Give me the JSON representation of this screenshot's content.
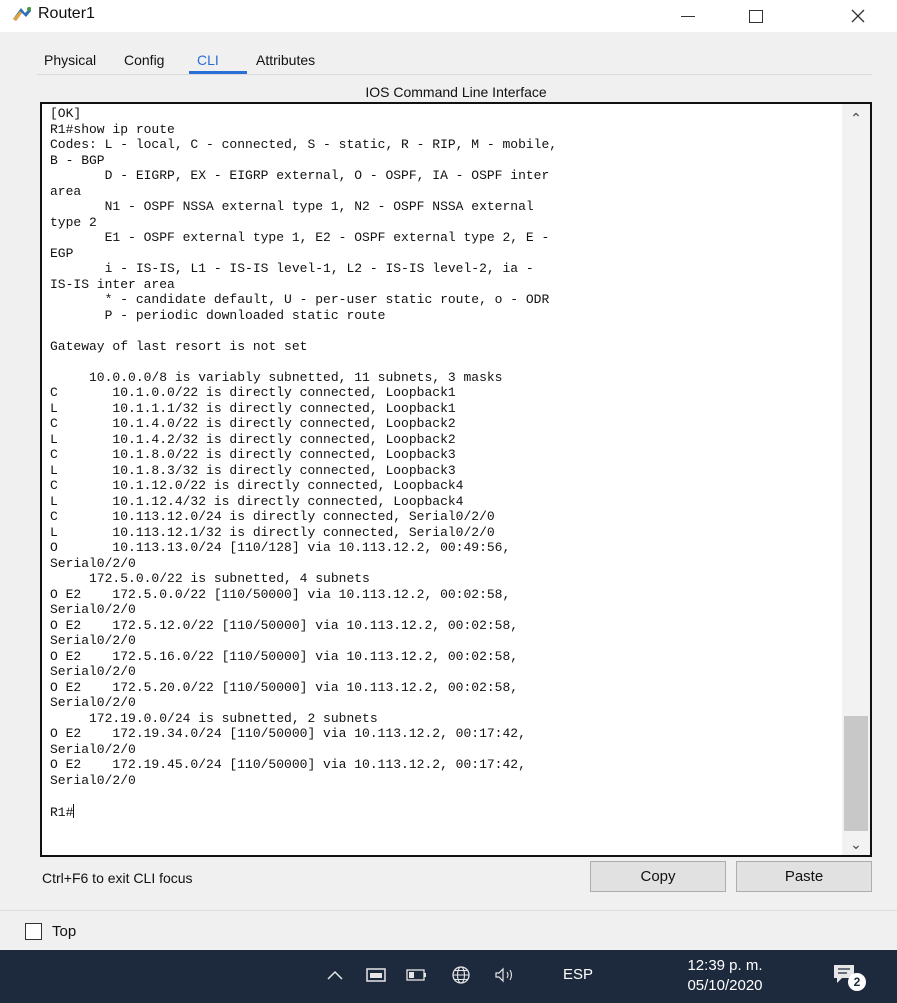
{
  "window": {
    "title": "Router1",
    "app_icon": "router-icon"
  },
  "tabs": [
    {
      "label": "Physical",
      "active": false
    },
    {
      "label": "Config",
      "active": false
    },
    {
      "label": "CLI",
      "active": true
    },
    {
      "label": "Attributes",
      "active": false
    }
  ],
  "cli": {
    "heading": "IOS Command Line Interface",
    "lines": [
      "[OK]",
      "R1#show ip route",
      "Codes: L - local, C - connected, S - static, R - RIP, M - mobile,",
      "B - BGP",
      "       D - EIGRP, EX - EIGRP external, O - OSPF, IA - OSPF inter",
      "area",
      "       N1 - OSPF NSSA external type 1, N2 - OSPF NSSA external",
      "type 2",
      "       E1 - OSPF external type 1, E2 - OSPF external type 2, E -",
      "EGP",
      "       i - IS-IS, L1 - IS-IS level-1, L2 - IS-IS level-2, ia -",
      "IS-IS inter area",
      "       * - candidate default, U - per-user static route, o - ODR",
      "       P - periodic downloaded static route",
      "",
      "Gateway of last resort is not set",
      "",
      "     10.0.0.0/8 is variably subnetted, 11 subnets, 3 masks",
      "C       10.1.0.0/22 is directly connected, Loopback1",
      "L       10.1.1.1/32 is directly connected, Loopback1",
      "C       10.1.4.0/22 is directly connected, Loopback2",
      "L       10.1.4.2/32 is directly connected, Loopback2",
      "C       10.1.8.0/22 is directly connected, Loopback3",
      "L       10.1.8.3/32 is directly connected, Loopback3",
      "C       10.1.12.0/22 is directly connected, Loopback4",
      "L       10.1.12.4/32 is directly connected, Loopback4",
      "C       10.113.12.0/24 is directly connected, Serial0/2/0",
      "L       10.113.12.1/32 is directly connected, Serial0/2/0",
      "O       10.113.13.0/24 [110/128] via 10.113.12.2, 00:49:56,",
      "Serial0/2/0",
      "     172.5.0.0/22 is subnetted, 4 subnets",
      "O E2    172.5.0.0/22 [110/50000] via 10.113.12.2, 00:02:58,",
      "Serial0/2/0",
      "O E2    172.5.12.0/22 [110/50000] via 10.113.12.2, 00:02:58,",
      "Serial0/2/0",
      "O E2    172.5.16.0/22 [110/50000] via 10.113.12.2, 00:02:58,",
      "Serial0/2/0",
      "O E2    172.5.20.0/22 [110/50000] via 10.113.12.2, 00:02:58,",
      "Serial0/2/0",
      "     172.19.0.0/24 is subnetted, 2 subnets",
      "O E2    172.19.34.0/24 [110/50000] via 10.113.12.2, 00:17:42,",
      "Serial0/2/0",
      "O E2    172.19.45.0/24 [110/50000] via 10.113.12.2, 00:17:42,",
      "Serial0/2/0",
      "",
      "R1#"
    ],
    "exit_hint": "Ctrl+F6 to exit CLI focus",
    "copy_label": "Copy",
    "paste_label": "Paste"
  },
  "top_checkbox": {
    "label": "Top",
    "checked": false
  },
  "taskbar": {
    "language": "ESP",
    "time": "12:39 p. m.",
    "date": "05/10/2020",
    "notification_count": "2"
  },
  "colors": {
    "accent": "#2a6fd6",
    "taskbar": "#1d2a3d"
  }
}
